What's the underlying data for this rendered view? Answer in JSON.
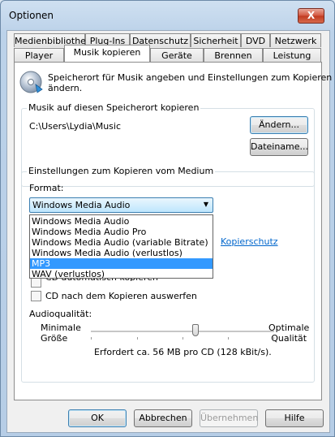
{
  "window": {
    "title": "Optionen",
    "close_glyph": "X"
  },
  "tabs_row1": [
    "Medienbibliothek",
    "Plug-Ins",
    "Datenschutz",
    "Sicherheit",
    "DVD",
    "Netzwerk"
  ],
  "tabs_row2": [
    "Player",
    "Musik kopieren",
    "Geräte",
    "Brennen",
    "Leistung"
  ],
  "active_tab": "Musik kopieren",
  "intro": {
    "icon": "cd-disc-icon",
    "line1": "Speicherort für Musik angeben und Einstellungen zum Kopieren",
    "line2": "ändern."
  },
  "location_group": {
    "label": "Musik auf diesen Speicherort kopieren",
    "path": "C:\\Users\\Lydia\\Music",
    "change_button": "Ändern...",
    "filename_button": "Dateiname..."
  },
  "rip_group": {
    "label": "Einstellungen zum Kopieren vom Medium",
    "format_label": "Format:",
    "format_value": "Windows Media Audio",
    "format_options": [
      "Windows Media Audio",
      "Windows Media Audio Pro",
      "Windows Media Audio (variable Bitrate)",
      "Windows Media Audio (verlustlos)",
      "MP3",
      "WAV (verlustlos)"
    ],
    "highlighted_option": "MP3",
    "copy_protection_link": "Kopierschutz",
    "auto_rip_partial": "CD automatisch kopieren",
    "eject_label": "CD nach dem Kopieren auswerfen",
    "quality_label": "Audioqualität:",
    "min_label_1": "Minimale",
    "min_label_2": "Größe",
    "max_label_1": "Optimale",
    "max_label_2": "Qualität",
    "quality_level": 0.57,
    "estimate": "Erfordert ca. 56 MB pro CD (128 kBit/s)."
  },
  "buttons": {
    "ok": "OK",
    "cancel": "Abbrechen",
    "apply": "Übernehmen",
    "help": "Hilfe"
  }
}
